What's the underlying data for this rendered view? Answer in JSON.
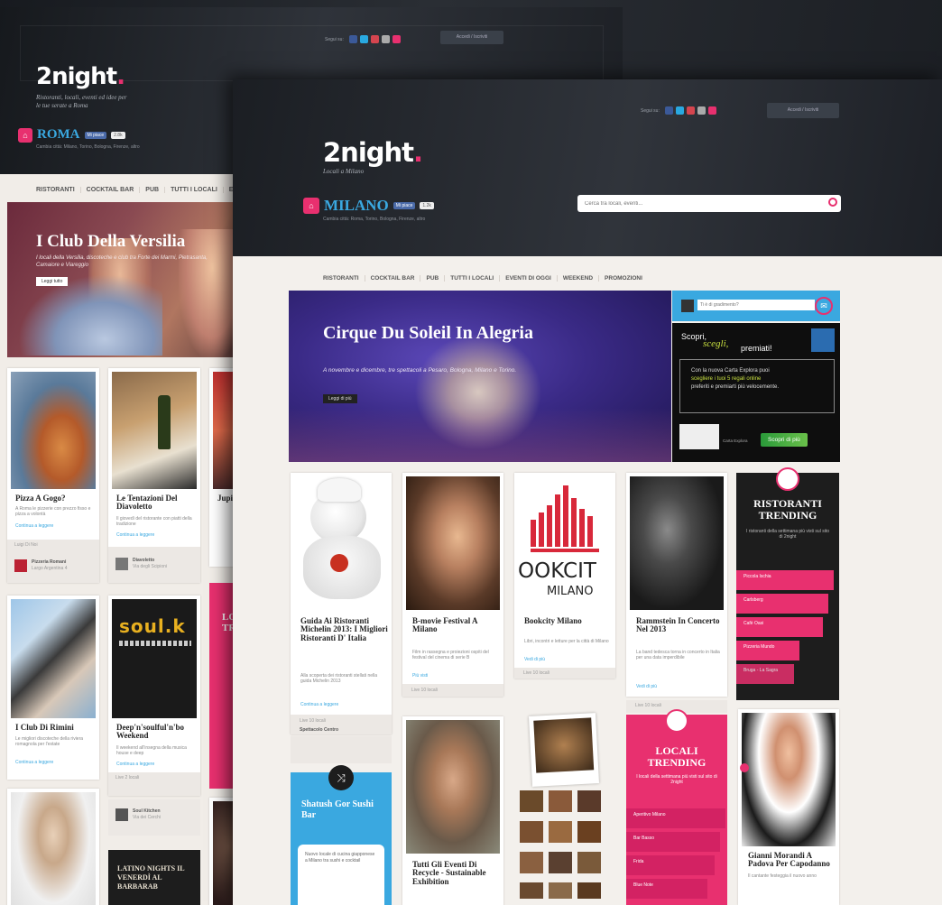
{
  "roma": {
    "logo": "2night",
    "logo_dot": ".",
    "tagline_line1": "Ristoranti, locali, eventi ed idee per",
    "tagline_line2": "le tue serate a Roma",
    "social_label": "Segui su:",
    "header_button": "Accedi / Iscriviti",
    "city": "ROMA",
    "like_label": "Mi piace",
    "like_count": "2.8k",
    "city_subtitle": "Cambia città: Milano, Torino, Bologna, Firenze, altro",
    "nav": [
      "RISTORANTI",
      "COCKTAIL BAR",
      "PUB",
      "TUTTI I LOCALI",
      "EV"
    ],
    "hero": {
      "title": "I Club Della Versilia",
      "text": "I locali della Versilia, discoteche e club tra Forte dei Marmi, Pietrasanta, Camaiore e Viareggio",
      "button": "Leggi tutto"
    },
    "cards": [
      {
        "title": "Pizza A Gogo?",
        "text": "A Roma le pizzerie con prezzo fisso e pizza a volontà",
        "link": "Continua a leggere",
        "foot": "Luigi Di Noi",
        "author": "Pizzeria Romani",
        "author_sub": "Largo Argentina 4"
      },
      {
        "title": "Le Tentazioni Del Diavoletto",
        "text": "Il giovedì del ristorante con piatti della tradizione",
        "link": "Continua a leggere",
        "foot": "",
        "author": "Diavoletto",
        "author_sub": "Via degli Scipioni"
      },
      {
        "title": "Jupi",
        "text": "",
        "link": ""
      },
      {
        "title": "I Club Di Rimini",
        "text": "Le migliori discoteche della riviera romagnola per l'estate",
        "link": "Continua a leggere"
      },
      {
        "title": "Deep'n'soulful'n'bo Weekend",
        "text": "Il weekend all'insegna della musica house e deep",
        "link": "Continua a leggere",
        "foot": "Live 2 locali",
        "author": "Soul Kitchen",
        "author_sub": "Via dei Cerchi"
      },
      {
        "title": "LATINO NIGHTS IL VENERDÌ AL BARBARAB",
        "text": ""
      }
    ],
    "soul_logo": "soul.k",
    "pink_card_title": "LO TRE"
  },
  "milano": {
    "logo": "2night",
    "logo_dot": ".",
    "tagline": "Locali a Milano",
    "social_label": "Segui su:",
    "header_button": "Accedi / Iscriviti",
    "city": "MILANO",
    "like_label": "Mi piace",
    "like_count": "1.2k",
    "city_subtitle": "Cambia città: Roma, Torino, Bologna, Firenze, altro",
    "search_placeholder": "Cerca tra locali, eventi...",
    "nav": [
      "RISTORANTI",
      "COCKTAIL BAR",
      "PUB",
      "TUTTI I LOCALI",
      "EVENTI DI OGGI",
      "WEEKEND",
      "PROMOZIONI"
    ],
    "hero": {
      "title": "Cirque Du Soleil In Alegria",
      "text": "A novembre e dicembre, tre spettacoli a Pesaro, Bologna, Milano e Torino.",
      "button": "Leggi di più"
    },
    "newsletter": {
      "placeholder": "Ti è di gradimento?"
    },
    "ad": {
      "line1": "Scopri,",
      "line2": "scegli,",
      "line3": "premiati!",
      "body1": "Con la nuova Carta Explora puoi",
      "body2": "scegliere i tuoi 5 regali online",
      "body3": "preferiti e premiarti più velocemente.",
      "card_name": "Carta Explora",
      "cta": "Scopri di più"
    },
    "cards": [
      {
        "title": "Guida Ai Ristoranti Michelin 2013: I Migliori Ristoranti D' Italia",
        "text": "Alla scoperta dei ristoranti stellati nella guida Michelin 2013",
        "link": "Continua a leggere",
        "foot": "Live 10 locali"
      },
      {
        "title": "B-movie Festival A Milano",
        "text": "Film in rassegna e proiezioni ospiti del festival del cinema di serie B",
        "link": "Più visti",
        "foot": "Live 10 locali"
      },
      {
        "title": "Bookcity Milano",
        "text": "Libri, incontri e letture per la città di Milano",
        "link": "Vedi di più",
        "foot": "Live 10 locali"
      },
      {
        "title": "Rammstein In Concerto Nel 2013",
        "text": "La band tedesca torna in concerto in Italia per una data imperdibile",
        "link": "Vedi di più",
        "foot": "Live 10 locali"
      },
      {
        "title": "Tutti Gli Eventi Di Recycle - Sustainable Exhibition",
        "text": ""
      },
      {
        "title": "Gianni Morandi A Padova Per Capodanno",
        "text": "Il cantante festeggia il nuovo anno"
      }
    ],
    "bookcity_logo": "OOKCIT",
    "bookcity_sub": "MILANO",
    "trending_rist": {
      "title": "RISTORANTI TRENDING",
      "intro": "I ristoranti della settimana più visti sul sito di 2night",
      "items": [
        "Piccola Ischia",
        "Carlsberg",
        "Cafè Oasi",
        "Pizzeria Mundo",
        "Bruga - La Sagra"
      ]
    },
    "trending_loc": {
      "title": "LOCALI TRENDING",
      "intro": "I locali della settimana più visti sul sito di 2night",
      "items": [
        "Aperitivo Milano",
        "Bar Basso",
        "Frida",
        "Blue Note",
        "Hollywood"
      ]
    },
    "shatush": {
      "title": "Shatush Gor Sushi Bar",
      "text": "Nuovo locale di cucina giapponese a Milano tra sushi e cocktail"
    },
    "michelin_foot_user": "Spettacolo Centro"
  },
  "colors": {
    "accent": "#e8306f",
    "link": "#3aa8e0",
    "header": "#24272c"
  }
}
